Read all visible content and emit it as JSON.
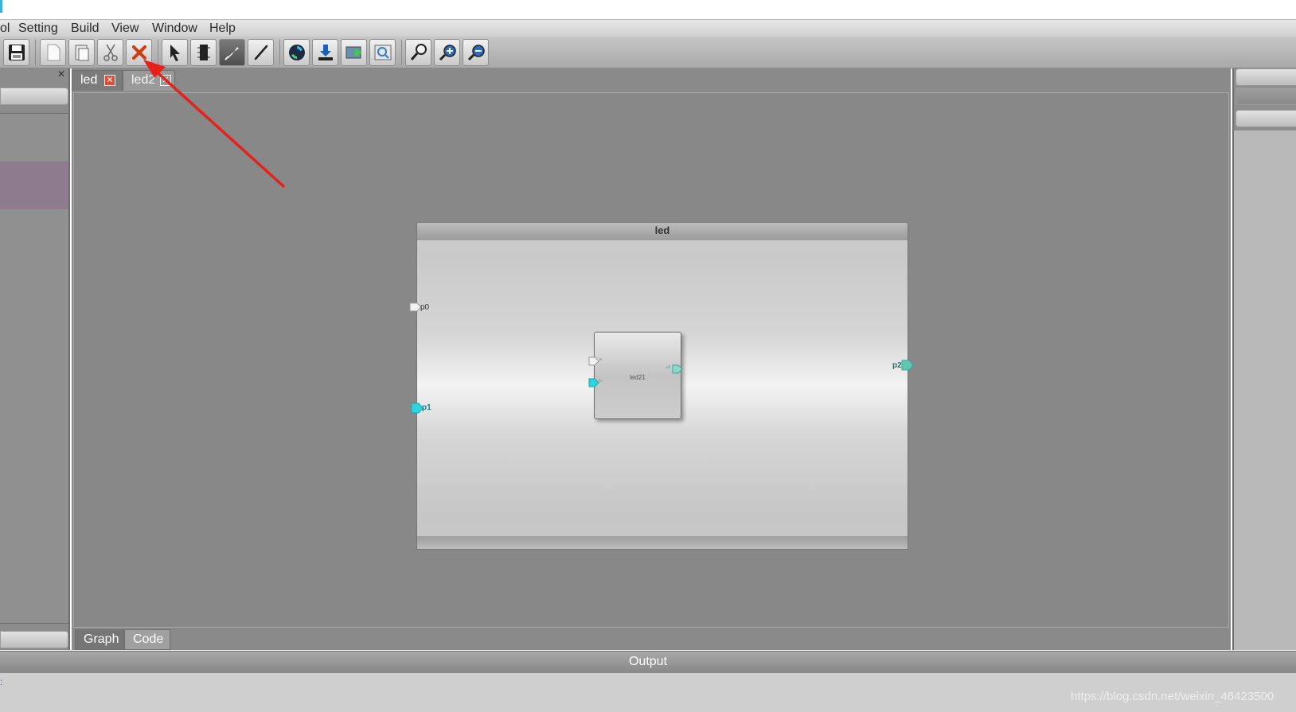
{
  "menu": {
    "items": [
      {
        "label": "ol",
        "key": "tool"
      },
      {
        "label": "Setting",
        "key": "setting"
      },
      {
        "label": "Build",
        "key": "build"
      },
      {
        "label": "View",
        "key": "view"
      },
      {
        "label": "Window",
        "key": "window"
      },
      {
        "label": "Help",
        "key": "help"
      }
    ]
  },
  "toolbar": {
    "buttons": [
      {
        "icon": "save-icon"
      },
      {
        "icon": "new-file-icon"
      },
      {
        "icon": "paste-icon"
      },
      {
        "icon": "cut-icon"
      },
      {
        "icon": "delete-icon"
      },
      {
        "icon": "select-arrow-icon"
      },
      {
        "icon": "component-icon"
      },
      {
        "icon": "pin-tool-icon"
      },
      {
        "icon": "wire-tool-icon"
      },
      {
        "icon": "refresh-icon"
      },
      {
        "icon": "download-icon"
      },
      {
        "icon": "run-icon"
      },
      {
        "icon": "preview-icon"
      },
      {
        "icon": "zoom-icon"
      },
      {
        "icon": "zoom-in-icon"
      },
      {
        "icon": "zoom-out-icon"
      }
    ]
  },
  "left_panel": {
    "close_glyph": "✕"
  },
  "editor": {
    "tabs": [
      {
        "label": "led",
        "close": "✕"
      },
      {
        "label": "led2",
        "close": "✕"
      }
    ],
    "bottom_tabs": [
      {
        "label": "Graph"
      },
      {
        "label": "Code"
      }
    ]
  },
  "diagram": {
    "block_title": "led",
    "ports": {
      "p0": "p0",
      "p1": "p1",
      "p2": "p2"
    },
    "inner_block": {
      "label": "led21",
      "in_a": "a",
      "in_b": "b",
      "out": "p2"
    }
  },
  "output": {
    "title": "Output",
    "prompt": ":",
    "watermark": "https://blog.csdn.net/weixin_46423500"
  },
  "colors": {
    "port_cyan": "#2fd4e0",
    "port_white": "#f2f2f2",
    "port_teal": "#5fc9b0",
    "arrow_red": "#e8201a",
    "selection_purple": "#8e7c8e"
  }
}
